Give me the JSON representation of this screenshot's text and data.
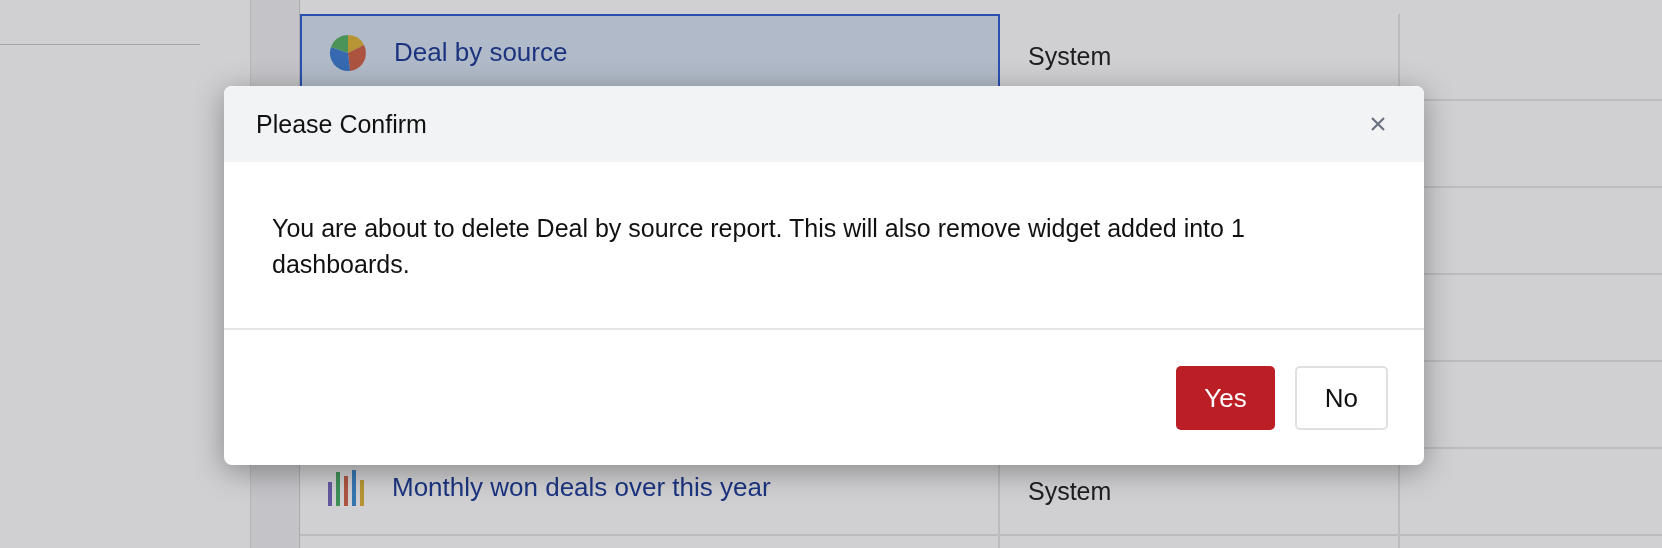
{
  "table": {
    "rows": [
      {
        "name": "Deal by source",
        "kind": "pie",
        "type": "System",
        "selected": true
      },
      {
        "name": "Monthly won deals over this year",
        "kind": "bars",
        "type": "System",
        "selected": false
      }
    ]
  },
  "dialog": {
    "title": "Please Confirm",
    "message": "You are about to delete Deal by source report. This will also remove widget added into 1 dashboards.",
    "buttons": [
      {
        "label": "Yes",
        "kind": "primary"
      },
      {
        "label": "No",
        "kind": "secondary"
      }
    ]
  }
}
